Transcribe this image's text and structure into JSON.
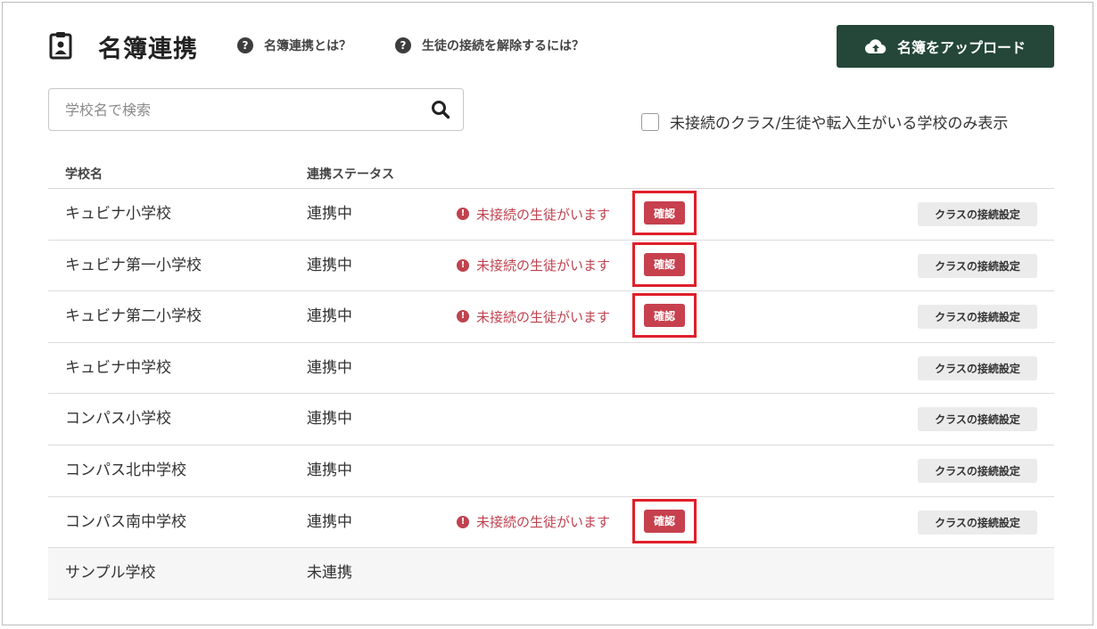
{
  "header": {
    "title": "名簿連携",
    "help_links": [
      "名簿連携とは？",
      "生徒の接続を解除するには？"
    ],
    "upload_label": "名簿をアップロード"
  },
  "search": {
    "placeholder": "学校名で検索"
  },
  "filter": {
    "label": "未接続のクラス/生徒や転入生がいる学校のみ表示",
    "checked": false
  },
  "table": {
    "columns": [
      "学校名",
      "連携ステータス"
    ],
    "warning_text": "未接続の生徒がいます",
    "confirm_label": "確認",
    "class_settings_label": "クラスの接続設定",
    "rows": [
      {
        "name": "キュビナ小学校",
        "status": "連携中",
        "warning": true
      },
      {
        "name": "キュビナ第一小学校",
        "status": "連携中",
        "warning": true
      },
      {
        "name": "キュビナ第二小学校",
        "status": "連携中",
        "warning": true
      },
      {
        "name": "キュビナ中学校",
        "status": "連携中",
        "warning": false
      },
      {
        "name": "コンパス小学校",
        "status": "連携中",
        "warning": false
      },
      {
        "name": "コンパス北中学校",
        "status": "連携中",
        "warning": false
      },
      {
        "name": "コンパス南中学校",
        "status": "連携中",
        "warning": true
      },
      {
        "name": "サンプル学校",
        "status": "未連携",
        "warning": false
      }
    ]
  },
  "colors": {
    "primary": "#24473a",
    "danger": "#c0424f",
    "highlight": "#e01f2b"
  },
  "icons": {
    "title": "clipboard-user-icon",
    "help": "question-circle-icon",
    "upload": "cloud-upload-icon",
    "search": "search-icon",
    "warning": "exclamation-circle-icon"
  }
}
